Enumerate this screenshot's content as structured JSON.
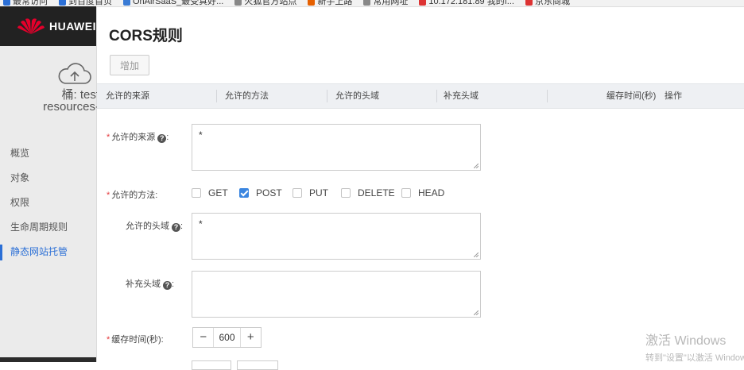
{
  "bookmarks": [
    {
      "label": "最常访问",
      "color": "#2b6fd6"
    },
    {
      "label": "到百度首页",
      "color": "#2b6fd6"
    },
    {
      "label": "OnAirSaaS_最受真好...",
      "color": "#3a7bd5"
    },
    {
      "label": "火狐官方站点",
      "color": "#888888"
    },
    {
      "label": "新手上路",
      "color": "#e66000"
    },
    {
      "label": "常用网址",
      "color": "#888888"
    },
    {
      "label": "10.172.181.89 我的f...",
      "color": "#d33"
    },
    {
      "label": "京东商城",
      "color": "#d33"
    }
  ],
  "brand": {
    "name": "HUAWEI",
    "logo_color": "#e4002b"
  },
  "bucket": {
    "label": "桶: test",
    "sub": "resources-"
  },
  "nav": [
    {
      "label": "概览",
      "active": false
    },
    {
      "label": "对象",
      "active": false
    },
    {
      "label": "权限",
      "active": false
    },
    {
      "label": "生命周期规则",
      "active": false
    },
    {
      "label": "静态网站托管",
      "active": true
    }
  ],
  "page": {
    "title": "CORS规则",
    "add_button": "增加"
  },
  "table": {
    "headers": [
      "允许的来源",
      "允许的方法",
      "允许的头域",
      "补充头域",
      "缓存时间(秒)",
      "操作"
    ]
  },
  "form": {
    "origin_label": "允许的来源",
    "origin_value": "*",
    "methods_label": "允许的方法:",
    "methods": [
      {
        "label": "GET",
        "checked": false
      },
      {
        "label": "POST",
        "checked": true
      },
      {
        "label": "PUT",
        "checked": false
      },
      {
        "label": "DELETE",
        "checked": false
      },
      {
        "label": "HEAD",
        "checked": false
      }
    ],
    "allowed_headers_label": "允许的头域",
    "allowed_headers_value": "*",
    "expose_headers_label": "补充头域",
    "expose_headers_value": "",
    "cache_label": "缓存时间(秒):",
    "cache_value": "600",
    "minus": "−",
    "plus": "+"
  },
  "watermark": {
    "line1": "激活 Windows",
    "line2": "转到\"设置\"以激活 Windows"
  },
  "colors": {
    "accent": "#2b6fd6",
    "required": "#e4393c",
    "checkbox_on": "#3b86e0"
  }
}
